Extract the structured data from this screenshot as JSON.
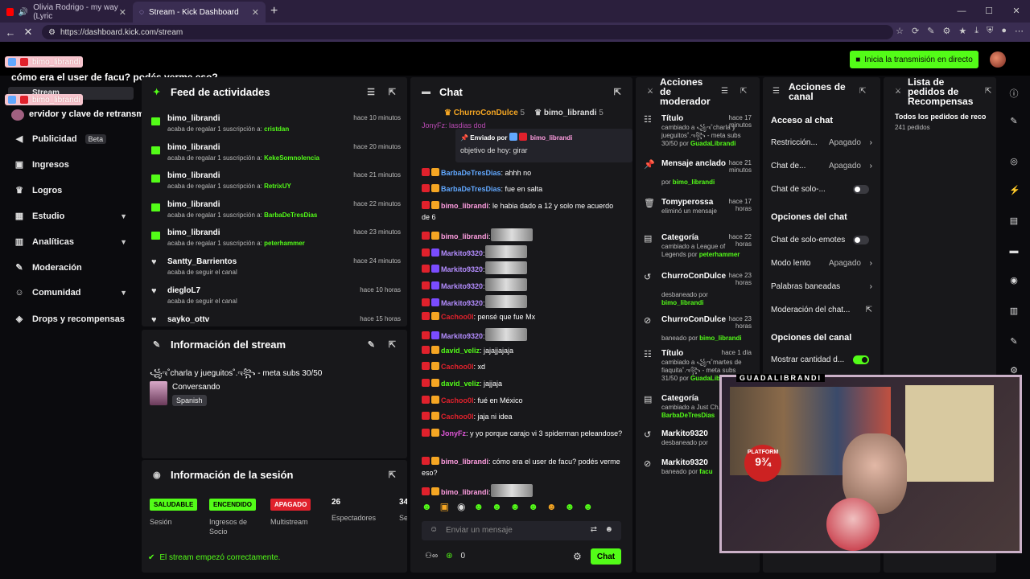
{
  "browser": {
    "tabs": [
      {
        "title": "Olivia Rodrigo - my way (Lyric"
      },
      {
        "title": "Stream - Kick Dashboard"
      }
    ],
    "url": "https://dashboard.kick.com/stream",
    "new_tab": "+"
  },
  "topbar": {
    "golive_label": "Inicia la transmisión en directo"
  },
  "overlay": {
    "chip1": "bimo_librandi",
    "chip2": "bimo_librandi",
    "msg": "cómo era el user de facu? podés verme eso?",
    "sub_text": "Stream",
    "msg2": "ervidor y clave de retransm"
  },
  "sidebar": {
    "items": [
      {
        "label": "Publicidad",
        "badge": "Beta",
        "icon": "megaphone-icon"
      },
      {
        "label": "Ingresos",
        "icon": "dollar-icon"
      },
      {
        "label": "Logros",
        "icon": "trophy-icon"
      },
      {
        "label": "Estudio",
        "icon": "grid-icon",
        "chevron": true
      },
      {
        "label": "Analíticas",
        "icon": "chart-icon",
        "chevron": true
      },
      {
        "label": "Moderación",
        "icon": "wrench-icon"
      },
      {
        "label": "Comunidad",
        "icon": "people-icon",
        "chevron": true
      },
      {
        "label": "Drops y recompensas",
        "icon": "gift-icon"
      }
    ]
  },
  "feed": {
    "title": "Feed de actividades",
    "rows": [
      {
        "user": "bimo_librandi",
        "time": "hace 10 minutos",
        "desc": "acaba de regalar 1 suscripción a: ",
        "target": "cristdan",
        "type": "gift"
      },
      {
        "user": "bimo_librandi",
        "time": "hace 20 minutos",
        "desc": "acaba de regalar 1 suscripción a: ",
        "target": "KekeSomnolencia",
        "type": "gift"
      },
      {
        "user": "bimo_librandi",
        "time": "hace 21 minutos",
        "desc": "acaba de regalar 1 suscripción a: ",
        "target": "RetrixUY",
        "type": "gift"
      },
      {
        "user": "bimo_librandi",
        "time": "hace 22 minutos",
        "desc": "acaba de regalar 1 suscripción a: ",
        "target": "BarbaDeTresDias",
        "type": "gift"
      },
      {
        "user": "bimo_librandi",
        "time": "hace 23 minutos",
        "desc": "acaba de regalar 1 suscripción a: ",
        "target": "peterhammer",
        "type": "gift"
      },
      {
        "user": "Santty_Barrientos",
        "time": "hace 24 minutos",
        "desc": "acaba de seguir el canal",
        "target": "",
        "type": "follow"
      },
      {
        "user": "diegloL7",
        "time": "hace 10 horas",
        "desc": "acaba de seguir el canal",
        "target": "",
        "type": "follow"
      },
      {
        "user": "sayko_ottv",
        "time": "hace 15 horas",
        "desc": "",
        "target": "",
        "type": "follow"
      }
    ]
  },
  "stream_info": {
    "title": "Información del stream",
    "stream_title": "꧁ಇ˚charla y jueguitos˚.ಇ꧂ - meta subs 30/50",
    "category": "Conversando",
    "language": "Spanish"
  },
  "session": {
    "title": "Información de la sesión",
    "stats": [
      {
        "value": "SALUDABLE",
        "label": "Sesión",
        "color": "#53fc18"
      },
      {
        "value": "ENCENDIDO",
        "label": "Ingresos de Socio",
        "color": "#53fc18"
      },
      {
        "value": "APAGADO",
        "label": "Multistream",
        "color": "#e0212c"
      },
      {
        "value": "26",
        "label": "Espectadores"
      },
      {
        "value": "34",
        "label": "Se"
      }
    ],
    "status": "El stream empezó correctamente."
  },
  "chat": {
    "title": "Chat",
    "top_gifters": [
      {
        "name": "ChurroConDulce",
        "count": "5"
      },
      {
        "name": "bimo_librandi",
        "count": "5"
      }
    ],
    "pinned": {
      "label": "Enviado por",
      "user": "bimo_librandi",
      "text": "objetivo de hoy: girar"
    },
    "clipped_top": "JonyFz: lasdias dod",
    "messages": [
      {
        "user": "BarbaDeTresDias",
        "text": ": ahhh no",
        "color": "#61a8ff"
      },
      {
        "user": "BarbaDeTresDias",
        "text": ": fue en salta",
        "color": "#61a8ff"
      },
      {
        "user": "bimo_librandi",
        "text": ": le habia dado a 12 y solo me acuerdo de 6",
        "color": "#ff9de0"
      },
      {
        "user": "bimo_librandi",
        "text": ":",
        "color": "#ff9de0",
        "img": true
      },
      {
        "user": "Markito9320",
        "text": ":",
        "color": "#b48dff",
        "img": true
      },
      {
        "user": "Markito9320",
        "text": ":",
        "color": "#b48dff",
        "img": true
      },
      {
        "user": "Markito9320",
        "text": ":",
        "color": "#b48dff",
        "img": true
      },
      {
        "user": "Markito9320",
        "text": ":",
        "color": "#b48dff",
        "img": true
      },
      {
        "user": "Cachoo0l",
        "text": ": pensé que fue Mx",
        "color": "#e0212c"
      },
      {
        "user": "Markito9320",
        "text": ":",
        "color": "#b48dff",
        "img": true
      },
      {
        "user": "david_veliz",
        "text": ": jajajjajaja",
        "color": "#53fc18"
      },
      {
        "user": "Cachoo0l",
        "text": ": xd",
        "color": "#e0212c"
      },
      {
        "user": "david_veliz",
        "text": ": jajjaja",
        "color": "#53fc18"
      },
      {
        "user": "Cachoo0l",
        "text": ": fué en México",
        "color": "#e0212c"
      },
      {
        "user": "Cachoo0l",
        "text": ": jaja ni idea",
        "color": "#e0212c"
      },
      {
        "user": "JonyFz",
        "text": ": y yo porque carajo vi 3 spiderman peleandose?",
        "color": "#e056d8"
      },
      {
        "user": "bimo_librandi",
        "text": ": cómo era el user de facu? podés verme eso?",
        "color": "#ff9de0"
      },
      {
        "user": "bimo_librandi",
        "text": ":",
        "color": "#ff9de0",
        "img": true
      }
    ],
    "input_placeholder": "Enviar un mensaje",
    "points": "0",
    "send_label": "Chat"
  },
  "mod_actions": {
    "title": "Acciones de moderador",
    "rows": [
      {
        "title": "Título",
        "time": "hace 17 minutos",
        "desc": "cambiado a ꧁ಇ˚charla y jueguitos˚.ಇ꧂ - meta subs 30/50 por ",
        "who": "GuadaLibrandi",
        "icon": "list-icon"
      },
      {
        "title": "Mensaje anclado",
        "time": "hace 21 minutos",
        "desc": "por ",
        "who": "bimo_librandi",
        "icon": "pin-icon"
      },
      {
        "title": "Tomyperossa",
        "time": "hace 17 horas",
        "desc": "eliminó un mensaje",
        "who": "",
        "icon": "trash-icon"
      },
      {
        "title": "Categoría",
        "time": "hace 22 horas",
        "desc": "cambiado a League of Legends por ",
        "who": "peterhammer",
        "icon": "category-icon"
      },
      {
        "title": "ChurroConDulce",
        "time": "hace 23 horas",
        "desc": "desbaneado por ",
        "who": "bimo_librandi",
        "icon": "unban-icon"
      },
      {
        "title": "ChurroConDulce",
        "time": "hace 23 horas",
        "desc": "baneado por ",
        "who": "bimo_librandi",
        "icon": "ban-icon"
      },
      {
        "title": "Título",
        "time": "hace 1 día",
        "desc": "cambiado a ꧁ಇ˚martes de fiaquita˚.ಇ꧂ - meta subs 31/50 por ",
        "who": "GuadaLibrandi",
        "icon": "list-icon"
      },
      {
        "title": "Categoría",
        "time": "",
        "desc": "cambiado a Just Ch... por ",
        "who": "BarbaDeTresDias",
        "icon": "category-icon"
      },
      {
        "title": "Markito9320",
        "time": "",
        "desc": "desbaneado por ",
        "who": "",
        "icon": "unban-icon"
      },
      {
        "title": "Markito9320",
        "time": "",
        "desc": "baneado por ",
        "who": "facu",
        "icon": "ban-icon"
      }
    ]
  },
  "channel_actions": {
    "title": "Acciones de canal",
    "chat_access_h": "Acceso al chat",
    "restriction": {
      "label": "Restricción...",
      "value": "Apagado"
    },
    "chat_de": {
      "label": "Chat de...",
      "value": "Apagado"
    },
    "chat_solo": "Chat de solo-...",
    "chat_options_h": "Opciones del chat",
    "emotes_only": "Chat de solo-emotes",
    "slow_mode": {
      "label": "Modo lento",
      "value": "Apagado"
    },
    "banned_words": "Palabras baneadas",
    "chat_moderation": "Moderación del chat...",
    "channel_options_h": "Opciones del canal",
    "show_count": "Mostrar cantidad d..."
  },
  "rewards": {
    "title": "Lista de pedidos de Recompensas",
    "all": "Todos los pedidos de reco",
    "count": "241 pedidos"
  },
  "webcam": {
    "overlay_name": "GUADALIBRANDI",
    "platform": "PLATFORM",
    "num": "9¾"
  },
  "colors": {
    "accent": "#53fc18",
    "bg": "#0b0b0e",
    "panel": "#18181b",
    "red": "#e0212c"
  }
}
